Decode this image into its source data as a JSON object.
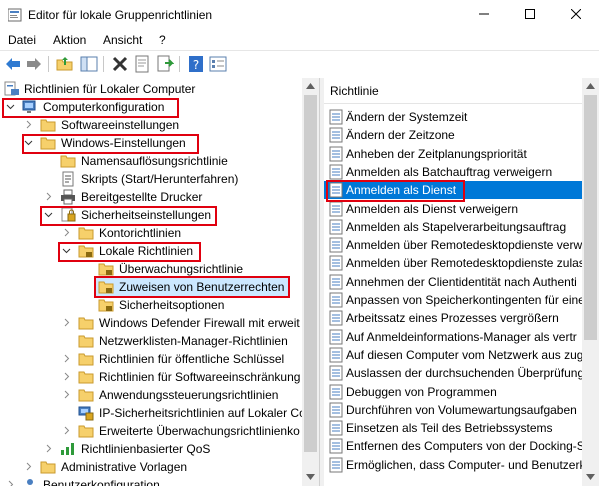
{
  "window": {
    "title": "Editor für lokale Gruppenrichtlinien"
  },
  "menu": [
    "Datei",
    "Aktion",
    "Ansicht",
    "?"
  ],
  "colors": {
    "selection_blue": "#0078d7",
    "selection_light": "#cce8ff",
    "highlight_red": "#e0000f",
    "folder_yellow": "#f6d06b"
  },
  "tree": {
    "items": [
      {
        "label": "Richtlinien für Lokaler Computer",
        "icon": "computer-policy-icon"
      },
      {
        "label": "Computerkonfiguration",
        "icon": "computer-icon",
        "expanded": true
      },
      {
        "label": "Softwareeinstellungen",
        "icon": "folder-icon"
      },
      {
        "label": "Windows-Einstellungen",
        "icon": "folder-icon",
        "expanded": true
      },
      {
        "label": "Namensauflösungsrichtlinie",
        "icon": "folder-icon"
      },
      {
        "label": "Skripts (Start/Herunterfahren)",
        "icon": "script-icon"
      },
      {
        "label": "Bereitgestellte Drucker",
        "icon": "printer-icon"
      },
      {
        "label": "Sicherheitseinstellungen",
        "icon": "security-icon",
        "expanded": true
      },
      {
        "label": "Kontorichtlinien",
        "icon": "folder-icon"
      },
      {
        "label": "Lokale Richtlinien",
        "icon": "folder-lock-icon",
        "expanded": true
      },
      {
        "label": "Überwachungsrichtlinie",
        "icon": "folder-lock-icon"
      },
      {
        "label": "Zuweisen von Benutzerrechten",
        "icon": "folder-lock-icon",
        "selected": true
      },
      {
        "label": "Sicherheitsoptionen",
        "icon": "folder-lock-icon"
      },
      {
        "label": "Windows Defender Firewall mit erweit",
        "icon": "folder-icon"
      },
      {
        "label": "Netzwerklisten-Manager-Richtlinien",
        "icon": "folder-icon"
      },
      {
        "label": "Richtlinien für öffentliche Schlüssel",
        "icon": "folder-icon"
      },
      {
        "label": "Richtlinien für Softwareeinschränkung",
        "icon": "folder-icon"
      },
      {
        "label": "Anwendungssteuerungsrichtlinien",
        "icon": "folder-icon"
      },
      {
        "label": "IP-Sicherheitsrichtlinien auf Lokaler Co",
        "icon": "ip-security-icon"
      },
      {
        "label": "Erweiterte Überwachungsrichtlinienko",
        "icon": "folder-icon"
      },
      {
        "label": "Richtlinienbasierter QoS",
        "icon": "qos-icon"
      },
      {
        "label": "Administrative Vorlagen",
        "icon": "folder-icon"
      },
      {
        "label": "Benutzerkonfiguration",
        "icon": "user-icon"
      }
    ]
  },
  "list": {
    "header": "Richtlinie",
    "items": [
      "Ändern der Systemzeit",
      "Ändern der Zeitzone",
      "Anheben der Zeitplanungspriorität",
      "Anmelden als Batchauftrag verweigern",
      "Anmelden als Dienst",
      "Anmelden als Dienst verweigern",
      "Anmelden als Stapelverarbeitungsauftrag",
      "Anmelden über Remotedesktopdienste verw",
      "Anmelden über Remotedesktopdienste zulas",
      "Annehmen der Clientidentität nach Authenti",
      "Anpassen von Speicherkontingenten für eine",
      "Arbeitssatz eines Prozesses vergrößern",
      "Auf Anmeldeinformations-Manager als vertr",
      "Auf diesen Computer vom Netzwerk aus zug",
      "Auslassen der durchsuchenden Überprüfung",
      "Debuggen von Programmen",
      "Durchführen von Volumewartungsaufgaben",
      "Einsetzen als Teil des Betriebssystems",
      "Entfernen des Computers von der Docking-S",
      "Ermöglichen, dass Computer- und Benutzerk"
    ],
    "selected_index": 4
  }
}
